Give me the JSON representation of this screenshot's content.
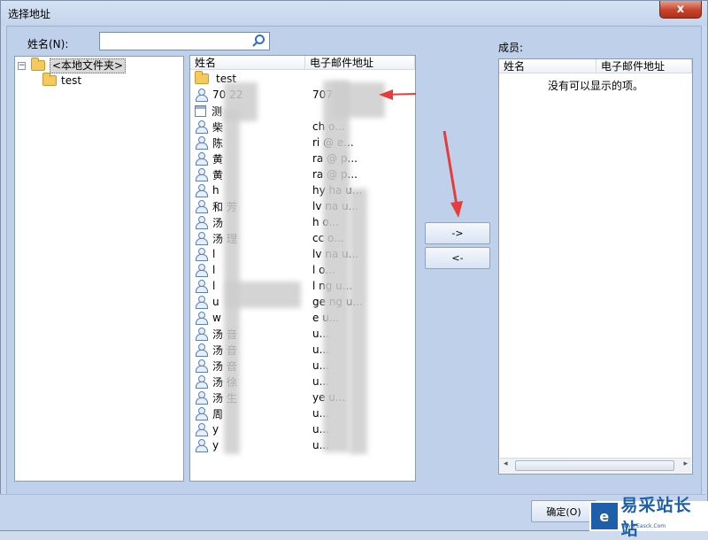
{
  "window": {
    "title": "选择地址",
    "close_label": "x"
  },
  "search": {
    "label": "姓名(N):",
    "value": ""
  },
  "tree": {
    "root_label": "<本地文件夹>",
    "expander": "−",
    "child_label": "test"
  },
  "address_list": {
    "col_name": "姓名",
    "col_email": "电子邮件地址",
    "rows": [
      {
        "icon": "folder-icon",
        "name": "test",
        "email": ""
      },
      {
        "icon": "contact-icon",
        "name": "70   22",
        "email": "707"
      },
      {
        "icon": "calendar-icon",
        "name": "测",
        "email": ""
      },
      {
        "icon": "contact-icon",
        "name": "柴",
        "email": "ch        o..."
      },
      {
        "icon": "contact-icon",
        "name": "陈",
        "email": "ri      @    e..."
      },
      {
        "icon": "contact-icon",
        "name": "黄",
        "email": "ra      @    p..."
      },
      {
        "icon": "contact-icon",
        "name": "黄",
        "email": "ra      @    p..."
      },
      {
        "icon": "contact-icon",
        "name": "h",
        "email": "hy       ha     u..."
      },
      {
        "icon": "contact-icon",
        "name": "和  芳",
        "email": "lv       na     u..."
      },
      {
        "icon": "contact-icon",
        "name": "汤",
        "email": "h              o..."
      },
      {
        "icon": "contact-icon",
        "name": "汤  理",
        "email": "cc             o..."
      },
      {
        "icon": "contact-icon",
        "name": "l",
        "email": "lv       na     u..."
      },
      {
        "icon": "contact-icon",
        "name": "l",
        "email": "l              o..."
      },
      {
        "icon": "contact-icon",
        "name": "l",
        "email": "l       ng      u..."
      },
      {
        "icon": "contact-icon",
        "name": "u",
        "email": "ge       ng      u..."
      },
      {
        "icon": "contact-icon",
        "name": "w",
        "email": "e             u..."
      },
      {
        "icon": "contact-icon",
        "name": "汤  音",
        "email": "          u..."
      },
      {
        "icon": "contact-icon",
        "name": "汤  音",
        "email": "          u..."
      },
      {
        "icon": "contact-icon",
        "name": "汤  音",
        "email": "          u..."
      },
      {
        "icon": "contact-icon",
        "name": "汤  徐",
        "email": "          u..."
      },
      {
        "icon": "contact-icon",
        "name": "汤  生",
        "email": "ye        u..."
      },
      {
        "icon": "contact-icon",
        "name": "周",
        "email": "            u..."
      },
      {
        "icon": "contact-icon",
        "name": "y",
        "email": "             u..."
      },
      {
        "icon": "contact-icon",
        "name": "y",
        "email": "              u..."
      }
    ]
  },
  "buttons": {
    "add": "->",
    "remove": "<-"
  },
  "members": {
    "label": "成员:",
    "col_name": "姓名",
    "col_email": "电子邮件地址",
    "empty_text": "没有可以显示的项。",
    "scroll_left": "◂",
    "scroll_right": "▸"
  },
  "footer": {
    "ok_label": "确定(O)"
  },
  "watermark": {
    "text": "易采站长站",
    "url": "Www.Easck.Com"
  },
  "colors": {
    "arrow": "#e53c3c",
    "accent": "#1f5fa9"
  }
}
